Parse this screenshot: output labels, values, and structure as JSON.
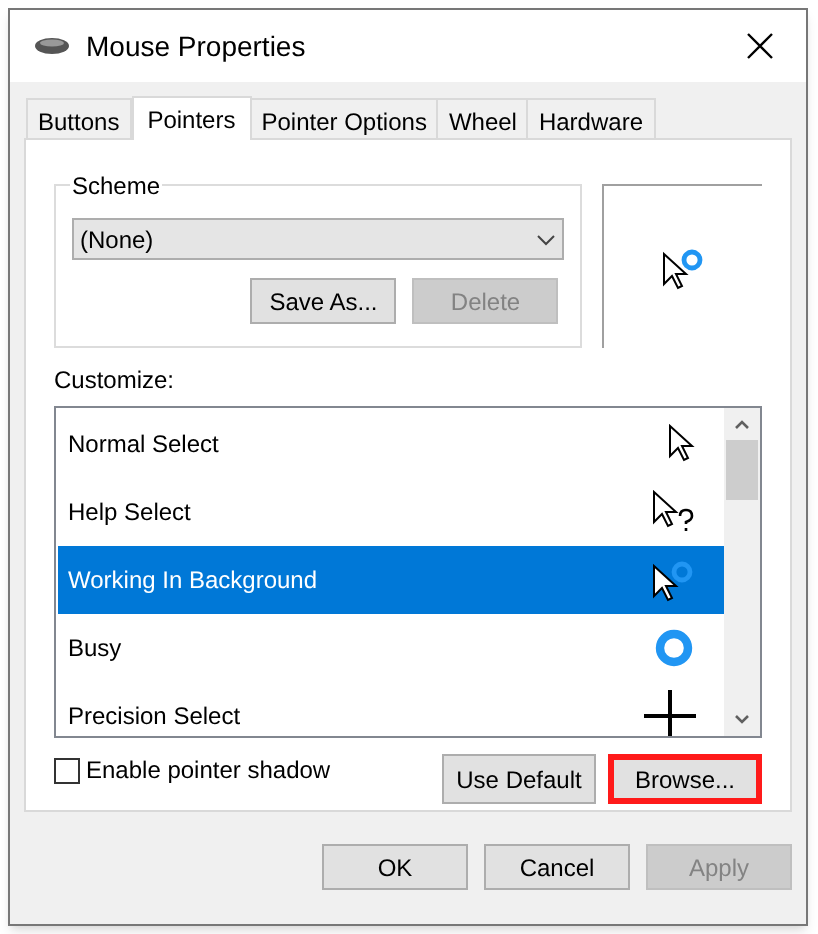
{
  "window": {
    "title": "Mouse Properties"
  },
  "tabs": [
    {
      "label": "Buttons",
      "selected": false
    },
    {
      "label": "Pointers",
      "selected": true
    },
    {
      "label": "Pointer Options",
      "selected": false
    },
    {
      "label": "Wheel",
      "selected": false
    },
    {
      "label": "Hardware",
      "selected": false
    }
  ],
  "scheme": {
    "label": "Scheme",
    "value": "(None)",
    "buttons": [
      {
        "label": "Save As...",
        "disabled": false
      },
      {
        "label": "Delete",
        "disabled": true
      }
    ]
  },
  "customize": {
    "label": "Customize:",
    "items": [
      {
        "label": "Normal Select",
        "kind": "arrow",
        "selected": false
      },
      {
        "label": "Help Select",
        "kind": "help",
        "selected": false
      },
      {
        "label": "Working In Background",
        "kind": "working",
        "selected": true
      },
      {
        "label": "Busy",
        "kind": "busy",
        "selected": false
      },
      {
        "label": "Precision Select",
        "kind": "cross",
        "selected": false
      }
    ]
  },
  "shadow": {
    "label": "Enable pointer shadow",
    "checked": false
  },
  "list_buttons": [
    {
      "label": "Use Default",
      "highlighted": false
    },
    {
      "label": "Browse...",
      "highlighted": true
    }
  ],
  "footer_buttons": [
    {
      "label": "OK",
      "disabled": false
    },
    {
      "label": "Cancel",
      "disabled": false
    },
    {
      "label": "Apply",
      "disabled": true
    }
  ]
}
